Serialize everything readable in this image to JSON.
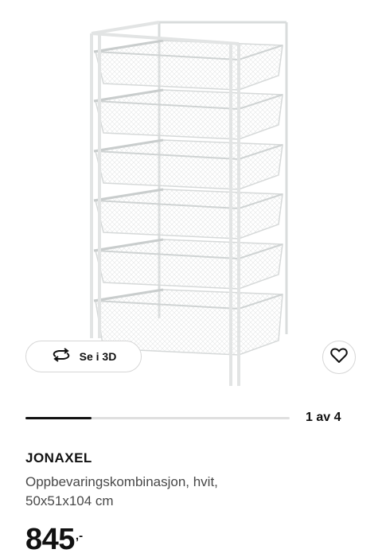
{
  "product_image": {
    "description_icon": "drawer-storage-unit-image"
  },
  "view_3d": {
    "label": "Se i 3D",
    "icon": "rotate-3d-icon"
  },
  "favorite": {
    "icon": "heart-icon"
  },
  "gallery": {
    "current": 1,
    "total": 4,
    "counter_label": "1 av 4",
    "progress_fraction": 0.25
  },
  "product": {
    "name": "JONAXEL",
    "description_line1": "Oppbevaringskombinasjon, hvit,",
    "description_line2": "50x51x104 cm"
  },
  "price": {
    "amount": "845",
    "suffix": ",-"
  },
  "colors": {
    "text": "#111111",
    "muted": "#484848",
    "border": "#d6d6d6",
    "track": "#dfdfdf"
  }
}
